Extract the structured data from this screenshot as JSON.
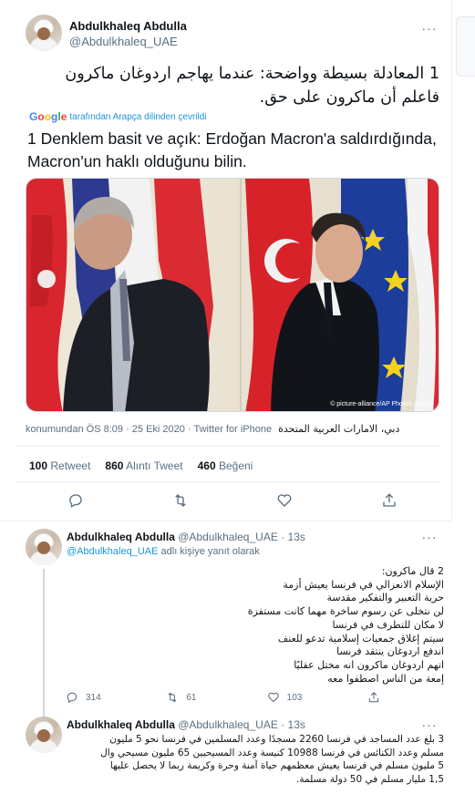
{
  "main_tweet": {
    "author_name": "Abdulkhaleq Abdulla",
    "author_handle": "@Abdulkhaleq_UAE",
    "text_arabic": "1 المعادلة بسيطة وواضحة: عندما يهاجم اردوغان ماكرون فاعلم أن ماكرون على حق.",
    "translated_by": "tarafından Arapça dilinden çevrildi",
    "translation_text": "1 Denklem basit ve açık: Erdoğan Macron'a saldırdığında, Macron'un haklı olduğunu bilin.",
    "photo_credit": "© picture-alliance/AP Photo/L. Marin",
    "meta_time": "konumundan ÖS 8:09 · 25 Eki 2020 · Twitter for iPhone",
    "meta_location": "دبي، الامارات العربية المتحدة",
    "retweets_count": "100",
    "retweets_label": "Retweet",
    "quotes_count": "860",
    "quotes_label": "Alıntı Tweet",
    "likes_count": "460",
    "likes_label": "Beğeni"
  },
  "replies": [
    {
      "author_name": "Abdulkhaleq Abdulla",
      "author_handle": "@Abdulkhaleq_UAE",
      "time": "· 13s",
      "reply_to_mention": "@Abdulkhaleq_UAE",
      "reply_to_suffix": "adlı kişiye yanıt olarak",
      "lines": [
        "2 قال ماكرون:",
        "الإسلام الانعزالي في فرنسا يعيش أزمة",
        "حرية التعبير والتفكير مقدسة",
        "لن نتخلى عن رسوم ساخرة مهما كانت مستفزة",
        "لا مكان للتطرف في فرنسا",
        "سيتم إغلاق جمعيات إسلامية تدعو للعنف",
        "اندفع اردوغان ينتقد فرنسا",
        "اتهم اردوغان ماكرون انه مختل عقليًا",
        "إمعة من الناس اصطفوا معه"
      ],
      "replies_count": "314",
      "retweets_count": "61",
      "likes_count": "103"
    },
    {
      "author_name": "Abdulkhaleq Abdulla",
      "author_handle": "@Abdulkhaleq_UAE",
      "time": "· 13s",
      "lines": [
        "3 بلغ عدد المساجد في فرنسا 2260 مسجدًا وعدد المسلمين في فرنسا نحو 5 مليون",
        "مسلم وعدد الكنائس في فرنسا 10988 كنيسة وعدد المسيحيين 65 مليون مسيحي وال",
        "5 مليون مسلم في فرنسا يعيش معظمهم حياة آمنة وحرة وكريمة ربما لا يحصل عليها",
        "1,5 مليار مسلم في 50 دولة مسلمة."
      ]
    }
  ]
}
